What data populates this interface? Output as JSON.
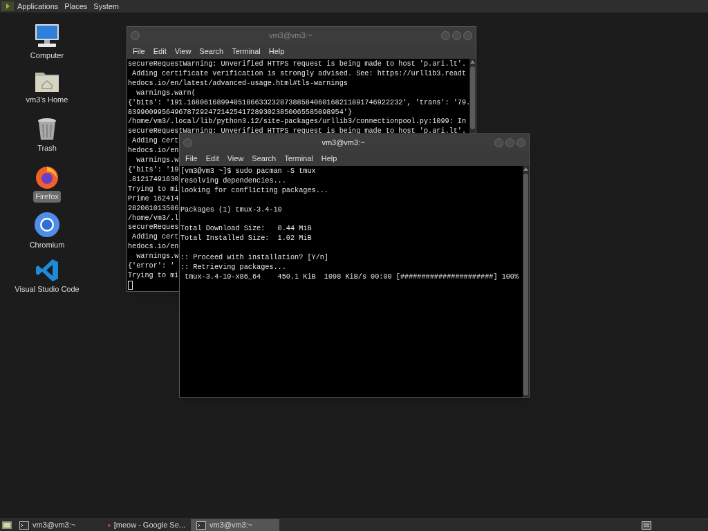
{
  "top_panel": {
    "menus": [
      "Applications",
      "Places",
      "System"
    ]
  },
  "desktop_icons": [
    {
      "label": "Computer",
      "kind": "computer",
      "selected": false
    },
    {
      "label": "vm3's Home",
      "kind": "home",
      "selected": false
    },
    {
      "label": "Trash",
      "kind": "trash",
      "selected": false
    },
    {
      "label": "Firefox",
      "kind": "firefox",
      "selected": true
    },
    {
      "label": "Chromium",
      "kind": "chromium",
      "selected": false
    },
    {
      "label": "Visual Studio Code",
      "kind": "vscode",
      "selected": false
    }
  ],
  "windows": [
    {
      "title": "vm3@vm3:~",
      "active": false,
      "menu": [
        "File",
        "Edit",
        "View",
        "Search",
        "Terminal",
        "Help"
      ],
      "cursor": true,
      "blocks": [
        [
          "secureRequestWarning: Unverified HTTPS request is being made to host 'p.ari.lt'.",
          " Adding certificate verification is strongly advised. See: https://urllib3.readt",
          "hedocs.io/en/latest/advanced-usage.html#tls-warnings",
          "  warnings.warn(",
          "{'bits': '191.168061689940518663323287388584060168211891746922232', 'trans': '79.",
          "839900995649678729247214254172893023850065585098954'}",
          "/home/vm3/.local/lib/python3.12/site-packages/urllib3/connectionpool.py:1099: In",
          "secureRequestWarning: Unverified HTTPS request is being made to host 'p.ari.lt'.",
          " Adding cert",
          "hedocs.io/en",
          "  warnings.w",
          "{'bits': '19",
          ".81217491630",
          "Trying to mi",
          "Prime 162414",
          "282061013506",
          "/home/vm3/.l",
          "secureReques",
          " Adding cert",
          "hedocs.io/en",
          "  warnings.w",
          "{'error': '",
          "Trying to mi"
        ]
      ]
    },
    {
      "title": "vm3@vm3:~",
      "active": true,
      "menu": [
        "File",
        "Edit",
        "View",
        "Search",
        "Terminal",
        "Help"
      ],
      "cursor": false,
      "blocks": [
        [
          "[vm3@vm3 ~]$ sudo pacman -S tmux",
          "resolving dependencies...",
          "looking for conflicting packages..."
        ],
        [
          "Packages (1) tmux-3.4-10"
        ],
        [
          "Total Download Size:   0.44 MiB",
          "Total Installed Size:  1.02 MiB"
        ],
        [
          ":: Proceed with installation? [Y/n]",
          ":: Retrieving packages...",
          " tmux-3.4-10-x86_64    450.1 KiB  1098 KiB/s 00:00 [######################] 100%"
        ]
      ]
    }
  ],
  "taskbar": {
    "items": [
      {
        "label": "vm3@vm3:~",
        "kind": "terminal",
        "selected": false
      },
      {
        "label": "[meow - Google Se...",
        "kind": "browser",
        "selected": false
      },
      {
        "label": "vm3@vm3:~",
        "kind": "terminal",
        "selected": true
      }
    ]
  }
}
